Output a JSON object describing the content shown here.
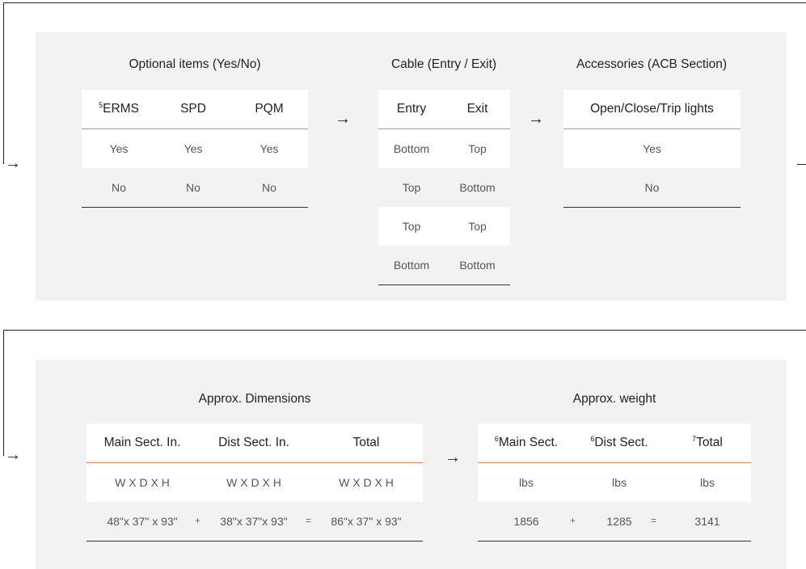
{
  "step_arrow": "→",
  "optional": {
    "title": "Optional items (Yes/No)",
    "headers": [
      {
        "sup": "5",
        "label": "ERMS"
      },
      {
        "sup": "",
        "label": "SPD"
      },
      {
        "sup": "",
        "label": "PQM"
      }
    ],
    "rows": [
      [
        "Yes",
        "Yes",
        "Yes"
      ],
      [
        "No",
        "No",
        "No"
      ]
    ]
  },
  "cable": {
    "title": "Cable (Entry / Exit)",
    "headers": [
      "Entry",
      "Exit"
    ],
    "rows": [
      [
        "Bottom",
        "Top"
      ],
      [
        "Top",
        "Bottom"
      ],
      [
        "Top",
        "Top"
      ],
      [
        "Bottom",
        "Bottom"
      ]
    ]
  },
  "accessories": {
    "title": "Accessories (ACB Section)",
    "header": "Open/Close/Trip lights",
    "rows": [
      "Yes",
      "No"
    ]
  },
  "dimensions": {
    "title": "Approx. Dimensions",
    "headers": [
      "Main Sect. In.",
      "Dist Sect. In.",
      "Total"
    ],
    "units": [
      "W X D X H",
      "W X D X H",
      "W X D X H"
    ],
    "values": [
      "48\"x 37\" x  93\"",
      "38\"x 37\"x 93\"",
      "86\"x 37\" x  93\""
    ],
    "plus": "+",
    "equals": "="
  },
  "weight": {
    "title": "Approx. weight",
    "headers": [
      {
        "sup": "6",
        "label": "Main Sect."
      },
      {
        "sup": "6",
        "label": "Dist Sect."
      },
      {
        "sup": "7",
        "label": "Total"
      }
    ],
    "units": [
      "lbs",
      "lbs",
      "lbs"
    ],
    "values": [
      "1856",
      "1285",
      "3141"
    ],
    "plus": "+",
    "equals": "="
  }
}
